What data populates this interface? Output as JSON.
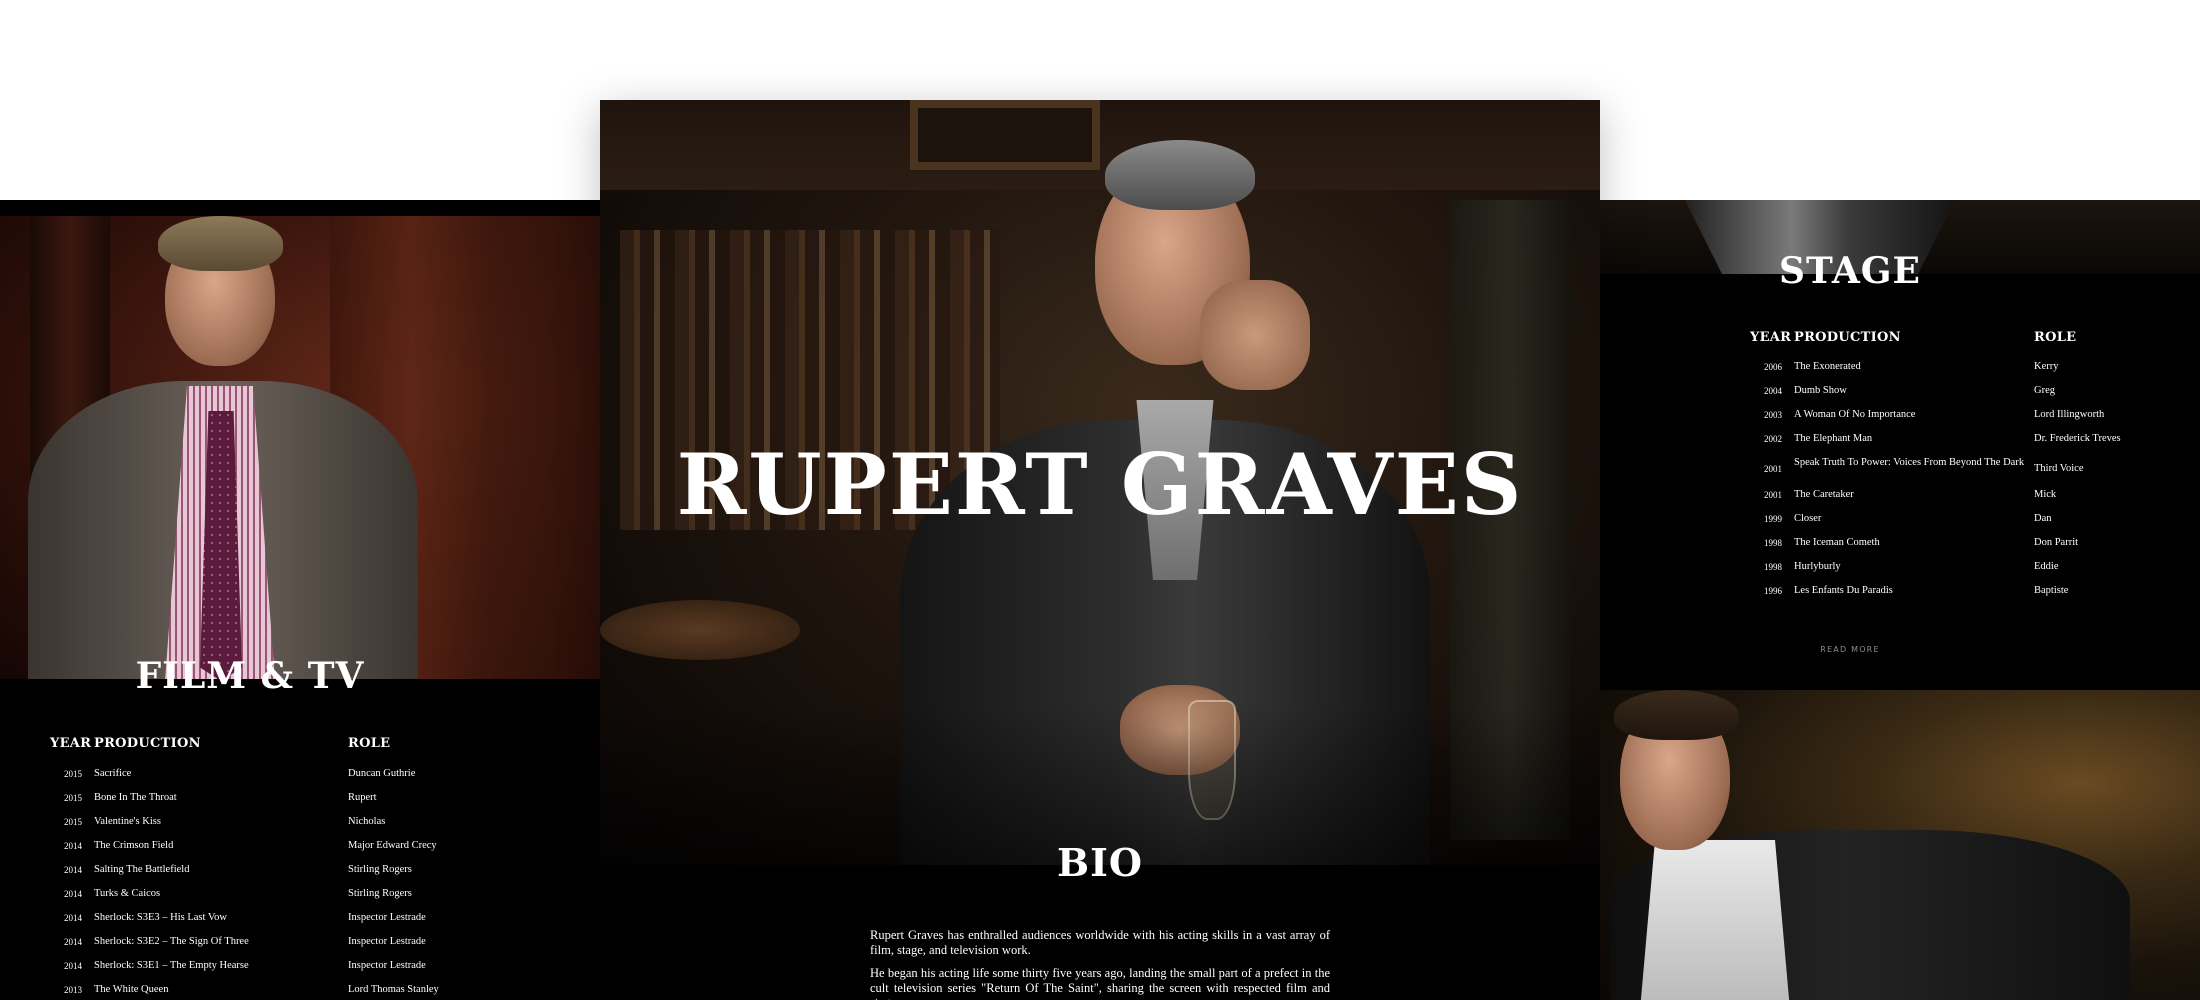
{
  "hero": {
    "name": "RUPERT GRAVES"
  },
  "film_tv": {
    "title": "FILM & TV",
    "headers": {
      "year": "YEAR",
      "production": "PRODUCTION",
      "role": "ROLE"
    },
    "rows": [
      {
        "year": "2015",
        "production": "Sacrifice",
        "role": "Duncan Guthrie"
      },
      {
        "year": "2015",
        "production": "Bone In The Throat",
        "role": "Rupert"
      },
      {
        "year": "2015",
        "production": "Valentine's Kiss",
        "role": "Nicholas"
      },
      {
        "year": "2014",
        "production": "The Crimson Field",
        "role": "Major Edward Crecy"
      },
      {
        "year": "2014",
        "production": "Salting The Battlefield",
        "role": "Stirling Rogers"
      },
      {
        "year": "2014",
        "production": "Turks & Caicos",
        "role": "Stirling Rogers"
      },
      {
        "year": "2014",
        "production": "Sherlock: S3E3 – His Last Vow",
        "role": "Inspector Lestrade"
      },
      {
        "year": "2014",
        "production": "Sherlock: S3E2 – The Sign Of Three",
        "role": "Inspector Lestrade"
      },
      {
        "year": "2014",
        "production": "Sherlock: S3E1 – The Empty Hearse",
        "role": "Inspector Lestrade"
      },
      {
        "year": "2013",
        "production": "The White Queen",
        "role": "Lord Thomas Stanley"
      }
    ]
  },
  "stage": {
    "title": "STAGE",
    "headers": {
      "year": "YEAR",
      "production": "PRODUCTION",
      "role": "ROLE"
    },
    "rows": [
      {
        "year": "2006",
        "production": "The Exonerated",
        "role": "Kerry"
      },
      {
        "year": "2004",
        "production": "Dumb Show",
        "role": "Greg"
      },
      {
        "year": "2003",
        "production": "A Woman Of No Importance",
        "role": "Lord Illingworth"
      },
      {
        "year": "2002",
        "production": "The Elephant Man",
        "role": "Dr. Frederick Treves"
      },
      {
        "year": "2001",
        "production": "Speak Truth To Power: Voices From Beyond The Dark",
        "role": "Third Voice"
      },
      {
        "year": "2001",
        "production": "The Caretaker",
        "role": "Mick"
      },
      {
        "year": "1999",
        "production": "Closer",
        "role": "Dan"
      },
      {
        "year": "1998",
        "production": "The Iceman Cometh",
        "role": "Don Parrit"
      },
      {
        "year": "1998",
        "production": "Hurlyburly",
        "role": "Eddie"
      },
      {
        "year": "1996",
        "production": "Les Enfants Du Paradis",
        "role": "Baptiste"
      }
    ],
    "read_more": "READ MORE"
  },
  "bio": {
    "title": "BIO",
    "paragraphs": [
      "Rupert Graves has enthralled audiences worldwide with his acting skills in a vast array of film, stage, and television work.",
      "He began his acting life some thirty five years ago, landing the small part of a prefect in the cult television series \"Return Of The Saint\", sharing the screen with respected film and stage"
    ]
  },
  "colors": {
    "background": "#ffffff",
    "panel": "#000000",
    "text": "#ffffff",
    "muted": "#8d8d8d"
  }
}
